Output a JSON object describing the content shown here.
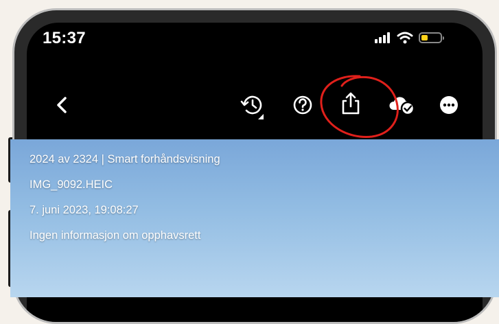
{
  "status_bar": {
    "time": "15:37",
    "icons": [
      "signal-icon",
      "wifi-icon",
      "battery-low-icon"
    ],
    "battery_color": "#ffd21a"
  },
  "toolbar": {
    "icons": [
      "back-chevron-icon",
      "history-icon",
      "help-icon",
      "share-icon",
      "cloud-synced-icon",
      "more-icon"
    ]
  },
  "photo_info": {
    "counter": "2024 av 2324 | Smart forhåndsvisning",
    "filename": "IMG_9092.HEIC",
    "datetime": "7. juni 2023, 19:08:27",
    "copyright": "Ingen informasjon om opphavsrett"
  },
  "annotation": {
    "color": "#e0201b",
    "target": "share-icon"
  }
}
